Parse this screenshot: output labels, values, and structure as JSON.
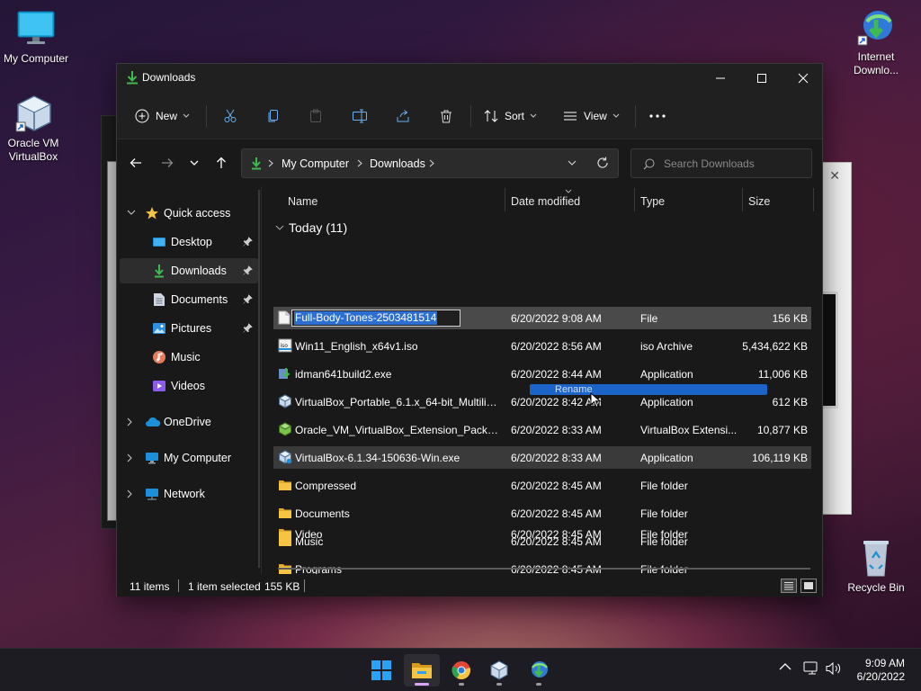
{
  "desktop": {
    "icons": [
      {
        "label": "My Computer"
      },
      {
        "label": "Oracle VM VirtualBox"
      },
      {
        "label": "Internet Downlo..."
      },
      {
        "label": "Recycle Bin"
      }
    ]
  },
  "window": {
    "title": "Downloads",
    "toolbar": {
      "new_label": "New",
      "sort_label": "Sort",
      "view_label": "View"
    },
    "address": {
      "crumbs": [
        "My Computer",
        "Downloads"
      ]
    },
    "search": {
      "placeholder": "Search Downloads"
    },
    "nav": {
      "quick_access": "Quick access",
      "items": [
        {
          "label": "Desktop",
          "pinned": true
        },
        {
          "label": "Downloads",
          "pinned": true,
          "selected": true
        },
        {
          "label": "Documents",
          "pinned": true
        },
        {
          "label": "Pictures",
          "pinned": true
        },
        {
          "label": "Music"
        },
        {
          "label": "Videos"
        }
      ],
      "roots": [
        {
          "label": "OneDrive"
        },
        {
          "label": "My Computer"
        },
        {
          "label": "Network"
        }
      ]
    },
    "columns": {
      "name": "Name",
      "date": "Date modified",
      "type": "Type",
      "size": "Size"
    },
    "group_label": "Today (11)",
    "files": [
      {
        "name": "Full-Body-Tones-2503481514",
        "date": "6/20/2022 9:08 AM",
        "type": "File",
        "size": "156 KB",
        "icon": "file-icon"
      },
      {
        "name": "Win11_English_x64v1.iso",
        "date": "6/20/2022 8:56 AM",
        "type": "iso Archive",
        "size": "5,434,622 KB",
        "icon": "iso-icon"
      },
      {
        "name": "idman641build2.exe",
        "date": "6/20/2022 8:44 AM",
        "type": "Application",
        "size": "11,006 KB",
        "icon": "idm-icon"
      },
      {
        "name": "VirtualBox_Portable_6.1.x_64-bit_Multilin...",
        "date": "6/20/2022 8:42 AM",
        "type": "Application",
        "size": "612 KB",
        "icon": "virtualbox-icon"
      },
      {
        "name": "Oracle_VM_VirtualBox_Extension_Pack-6....",
        "date": "6/20/2022 8:33 AM",
        "type": "VirtualBox Extensi...",
        "size": "10,877 KB",
        "icon": "vbox-extension-icon"
      },
      {
        "name": "VirtualBox-6.1.34-150636-Win.exe",
        "date": "6/20/2022 8:33 AM",
        "type": "Application",
        "size": "106,119 KB",
        "icon": "virtualbox-icon"
      },
      {
        "name": "Compressed",
        "date": "6/20/2022 8:45 AM",
        "type": "File folder",
        "size": "",
        "icon": "folder-icon"
      },
      {
        "name": "Documents",
        "date": "6/20/2022 8:45 AM",
        "type": "File folder",
        "size": "",
        "icon": "folder-icon"
      },
      {
        "name": "Music",
        "date": "6/20/2022 8:45 AM",
        "type": "File folder",
        "size": "",
        "icon": "folder-icon"
      },
      {
        "name": "Programs",
        "date": "6/20/2022 8:45 AM",
        "type": "File folder",
        "size": "",
        "icon": "folder-icon"
      },
      {
        "name": "Video",
        "date": "6/20/2022 8:45 AM",
        "type": "File folder",
        "size": "",
        "icon": "folder-icon"
      }
    ],
    "rename_value": "Full-Body-Tones-2503481514",
    "drag_tooltip": "Rename",
    "status": {
      "items": "11 items",
      "selected": "1 item selected",
      "selected_size": "155 KB"
    }
  },
  "taskbar": {
    "apps": [
      "start-icon",
      "file-explorer-icon",
      "chrome-icon",
      "virtualbox-icon",
      "idm-icon"
    ],
    "time": "9:09 AM",
    "date": "6/20/2022"
  },
  "colors": {
    "accent": "#2d6fd0",
    "folder": "#f6c443",
    "download_green": "#3fb950"
  }
}
